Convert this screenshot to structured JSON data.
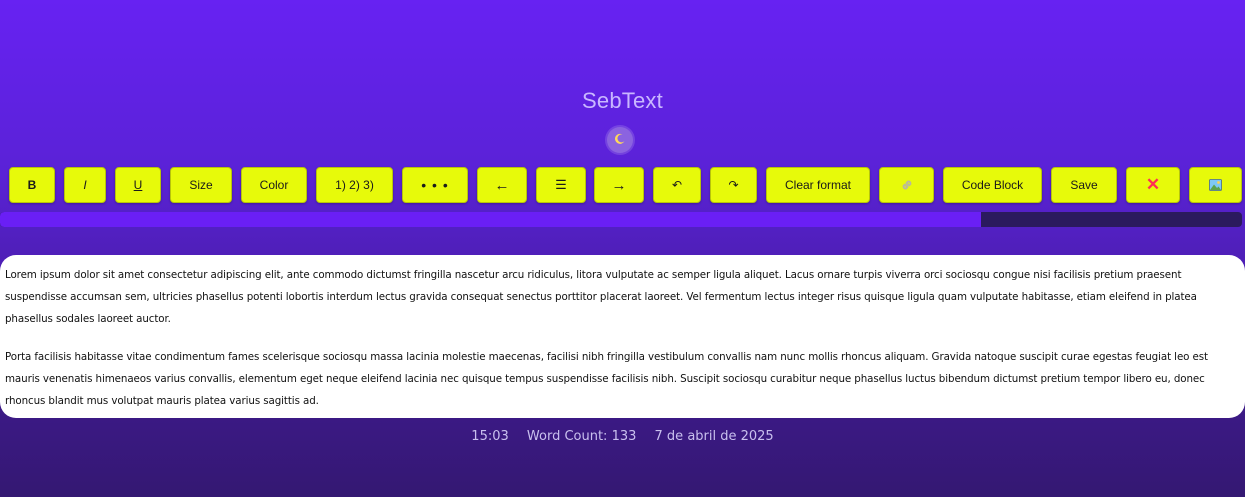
{
  "app": {
    "title": "SebText",
    "theme_toggle_icon": "moon-icon"
  },
  "toolbar": {
    "bold": "B",
    "italic": "I",
    "underline": "U",
    "size": "Size",
    "color": "Color",
    "ordered_list": "1) 2) 3)",
    "bullet_list": "• • •",
    "align_left": "←",
    "align_center": "☰",
    "align_right": "→",
    "undo": "↶",
    "redo": "↷",
    "clear_format": "Clear format",
    "link_icon": "link-icon",
    "code_block": "Code Block",
    "save": "Save",
    "delete": "✕",
    "delete_color": "#ff2d55",
    "image_icon": "image-icon"
  },
  "progress": {
    "fraction": 0.79
  },
  "editor": {
    "paragraphs": [
      "Lorem ipsum dolor sit amet consectetur adipiscing elit, ante commodo dictumst fringilla nascetur arcu ridiculus, litora vulputate ac semper ligula aliquet. Lacus ornare turpis viverra orci sociosqu congue nisi facilisis pretium praesent suspendisse accumsan sem, ultricies phasellus potenti lobortis interdum lectus gravida consequat senectus porttitor placerat laoreet. Vel fermentum lectus integer risus quisque ligula quam vulputate habitasse, etiam eleifend in platea phasellus sodales laoreet auctor.",
      "Porta facilisis habitasse vitae condimentum fames scelerisque sociosqu massa lacinia molestie maecenas, facilisi nibh fringilla vestibulum convallis nam nunc mollis rhoncus aliquam. Gravida natoque suscipit curae egestas feugiat leo est mauris venenatis himenaeos varius convallis, elementum eget neque eleifend lacinia nec quisque tempus suspendisse facilisis nibh. Suscipit sociosqu curabitur neque phasellus luctus bibendum dictumst pretium tempor libero eu, donec rhoncus blandit mus volutpat mauris platea varius sagittis ad."
    ]
  },
  "status": {
    "time": "15:03",
    "word_count": "Word Count: 133",
    "date": "7 de abril de 2025"
  },
  "colors": {
    "button_bg": "#e7fa0a",
    "progress_fill": "#6a1ff5",
    "progress_track": "#2b1a5e",
    "background_top": "#6722f2",
    "background_bottom": "#341872"
  }
}
